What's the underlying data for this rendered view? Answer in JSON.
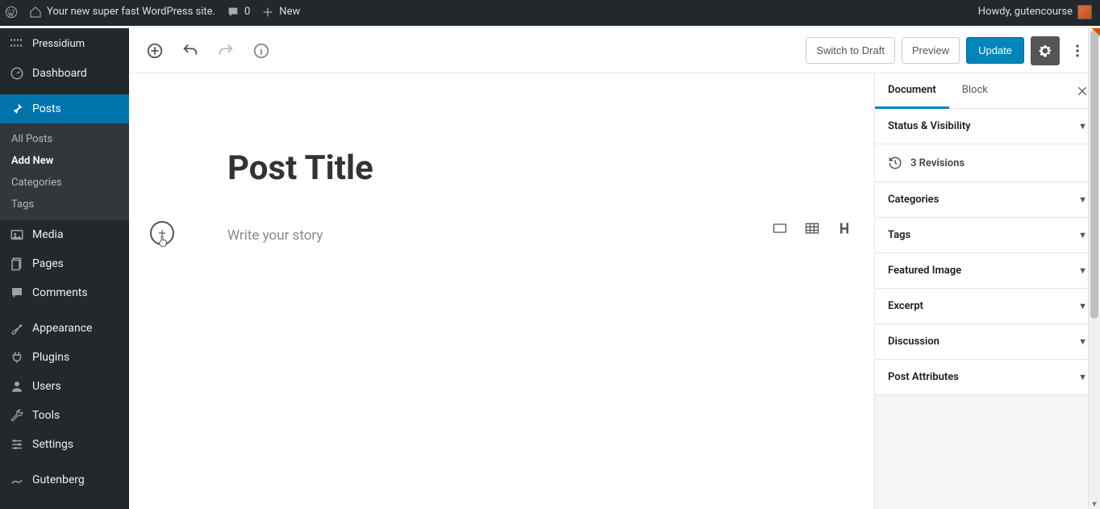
{
  "adminbar": {
    "site_name": "Your new super fast WordPress site.",
    "comments_count": "0",
    "new_label": "New",
    "howdy": "Howdy, gutencourse"
  },
  "sidebar": {
    "host": "Pressidium",
    "items": [
      {
        "label": "Dashboard"
      },
      {
        "label": "Posts"
      },
      {
        "label": "Media"
      },
      {
        "label": "Pages"
      },
      {
        "label": "Comments"
      },
      {
        "label": "Appearance"
      },
      {
        "label": "Plugins"
      },
      {
        "label": "Users"
      },
      {
        "label": "Tools"
      },
      {
        "label": "Settings"
      },
      {
        "label": "Gutenberg"
      }
    ],
    "posts_submenu": [
      {
        "label": "All Posts"
      },
      {
        "label": "Add New"
      },
      {
        "label": "Categories"
      },
      {
        "label": "Tags"
      }
    ]
  },
  "toolbar": {
    "switch_draft": "Switch to Draft",
    "preview": "Preview",
    "update": "Update"
  },
  "editor": {
    "title": "Post Title",
    "placeholder": "Write your story"
  },
  "inspector": {
    "tabs": {
      "document": "Document",
      "block": "Block"
    },
    "revisions_count": "3 Revisions",
    "panels": {
      "status": "Status & Visibility",
      "categories": "Categories",
      "tags": "Tags",
      "featured": "Featured Image",
      "excerpt": "Excerpt",
      "discussion": "Discussion",
      "attributes": "Post Attributes"
    }
  }
}
